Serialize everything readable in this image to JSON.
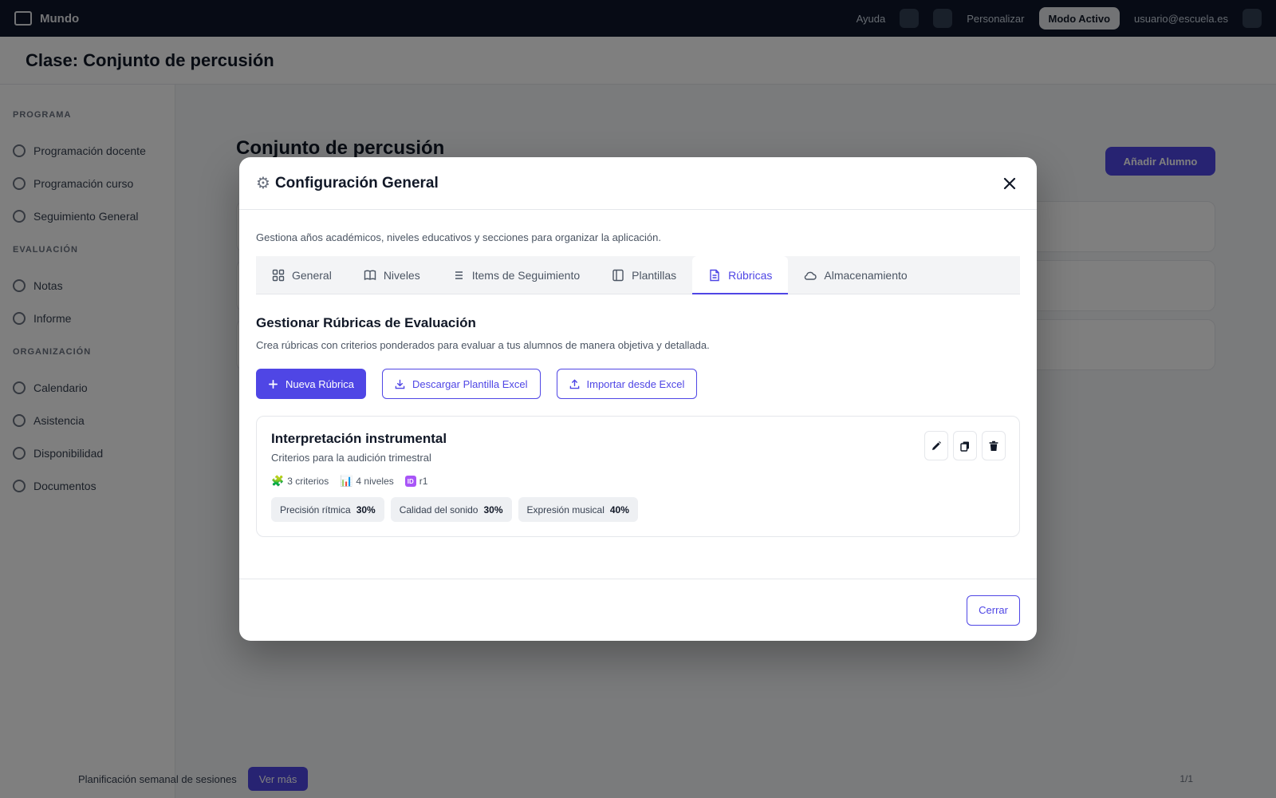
{
  "app": {
    "brand": "Mundo",
    "topbar": {
      "help": "Ayuda",
      "customize": "Personalizar",
      "account_pill": "Modo Activo",
      "user": "usuario@escuela.es"
    },
    "page_title": "Clase: Conjunto de percusión",
    "sidebar": {
      "sections": [
        {
          "title": "PROGRAMA",
          "items": [
            "Programación docente",
            "Programación curso",
            "Seguimiento General"
          ]
        },
        {
          "title": "EVALUACIÓN",
          "items": [
            "Notas",
            "Informe"
          ]
        },
        {
          "title": "ORGANIZACIÓN",
          "items": [
            "Calendario",
            "Asistencia",
            "Disponibilidad",
            "Documentos"
          ]
        }
      ]
    },
    "main_title": "Conjunto de percusión",
    "main_button": "Añadir Alumno",
    "bottombar": {
      "text": "Planificación semanal de sesiones",
      "button": "Ver más",
      "page": "1/1"
    }
  },
  "modal": {
    "title": "Configuración General",
    "title_icon": "gear-icon",
    "description": "Gestiona años académicos, niveles educativos y secciones para organizar la aplicación.",
    "tabs": [
      {
        "label": "General",
        "icon": "grid-icon"
      },
      {
        "label": "Niveles",
        "icon": "book-icon"
      },
      {
        "label": "Items de Seguimiento",
        "icon": "list-icon"
      },
      {
        "label": "Plantillas",
        "icon": "layout-icon"
      },
      {
        "label": "Rúbricas",
        "icon": "document-icon",
        "active": true
      },
      {
        "label": "Almacenamiento",
        "icon": "cloud-icon"
      }
    ],
    "section": {
      "title": "Gestionar Rúbricas de Evaluación",
      "description": "Crea rúbricas con criterios ponderados para evaluar a tus alumnos de manera objetiva y detallada."
    },
    "actions": {
      "new": "Nueva Rúbrica",
      "download": "Descargar Plantilla Excel",
      "import": "Importar desde Excel"
    },
    "rubrics": [
      {
        "name": "Interpretación instrumental",
        "subtitle": "Criterios para la audición trimestral",
        "criteria_count": "3 criterios",
        "levels_count": "4 niveles",
        "id_label": "r1",
        "id_badge": "ID",
        "criteria": [
          {
            "name": "Precisión rítmica",
            "weight": "30%"
          },
          {
            "name": "Calidad del sonido",
            "weight": "30%"
          },
          {
            "name": "Expresión musical",
            "weight": "40%"
          }
        ]
      }
    ],
    "close_label": "Cerrar"
  },
  "colors": {
    "accent": "#4f46e5",
    "topbar": "#0f172a"
  }
}
